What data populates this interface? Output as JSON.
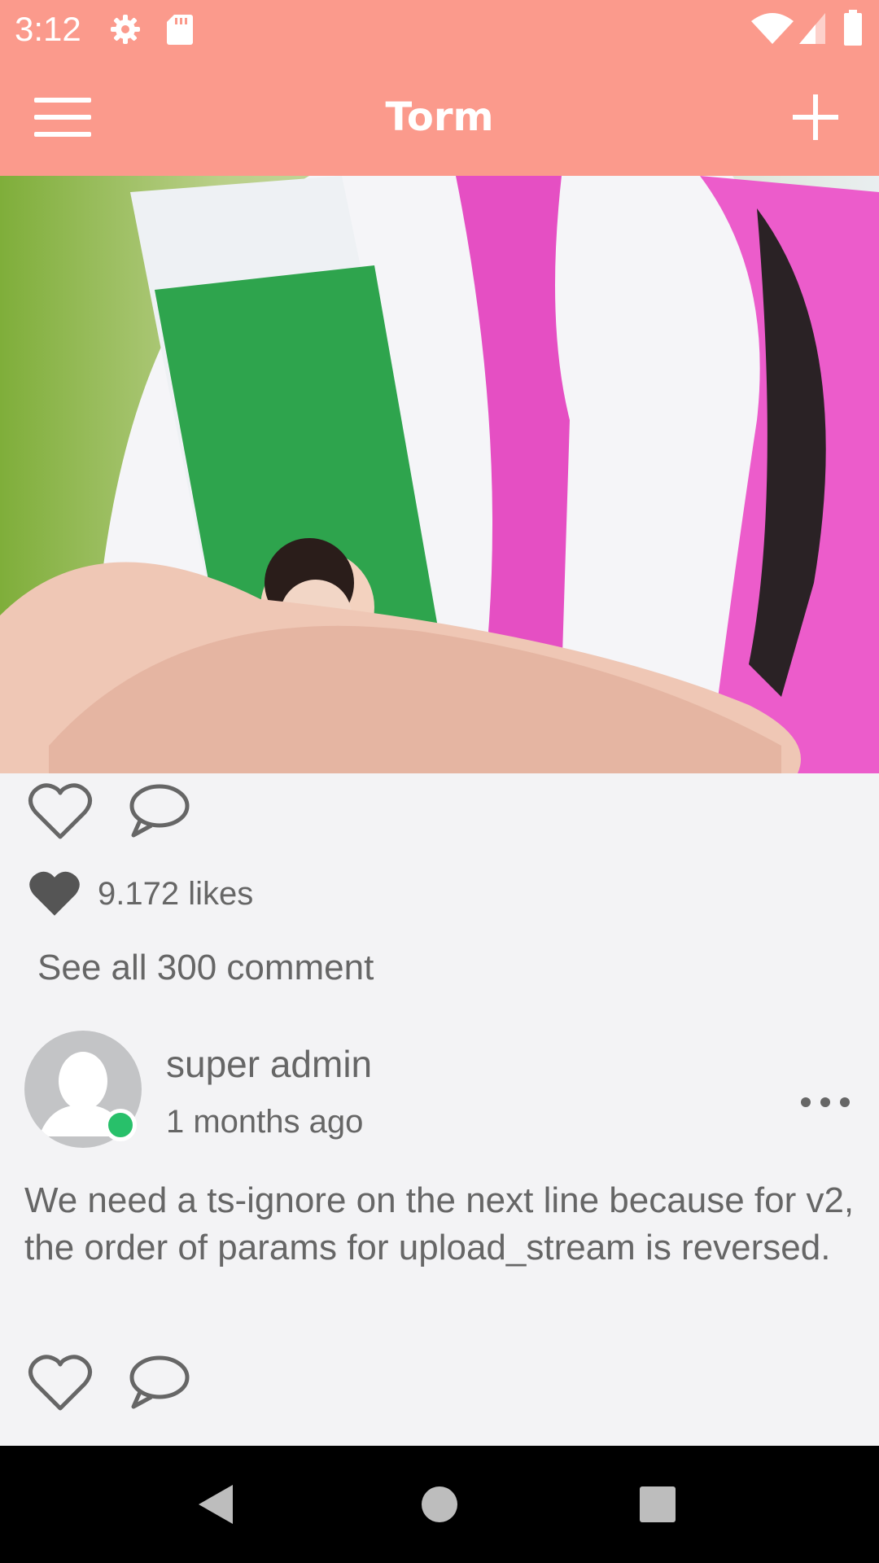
{
  "status_bar": {
    "time": "3:12",
    "icons": [
      "settings-icon",
      "sd-card-icon",
      "wifi-icon",
      "signal-icon",
      "battery-icon"
    ],
    "background": "#fb9a8c"
  },
  "app_bar": {
    "title": "Torm",
    "left_icon": "menu-icon",
    "right_icon": "add-icon",
    "background": "#fb9a8c"
  },
  "post": {
    "image_alt": "photo",
    "actions": [
      "heart-outline-icon",
      "comment-icon"
    ],
    "likes": "9.172 likes",
    "see_all_comments": "See all 300 comment"
  },
  "comment": {
    "author": "super admin",
    "time": "1 months ago",
    "online_color": "#28c06a",
    "text": "We need a ts-ignore on the next line because for v2, the order of params for upload_stream is reversed.",
    "actions": [
      "heart-outline-icon",
      "comment-icon"
    ],
    "more_icon": "more-horizontal-icon"
  },
  "nav_bar": {
    "buttons": [
      "back-icon",
      "home-icon",
      "recents-icon"
    ]
  }
}
